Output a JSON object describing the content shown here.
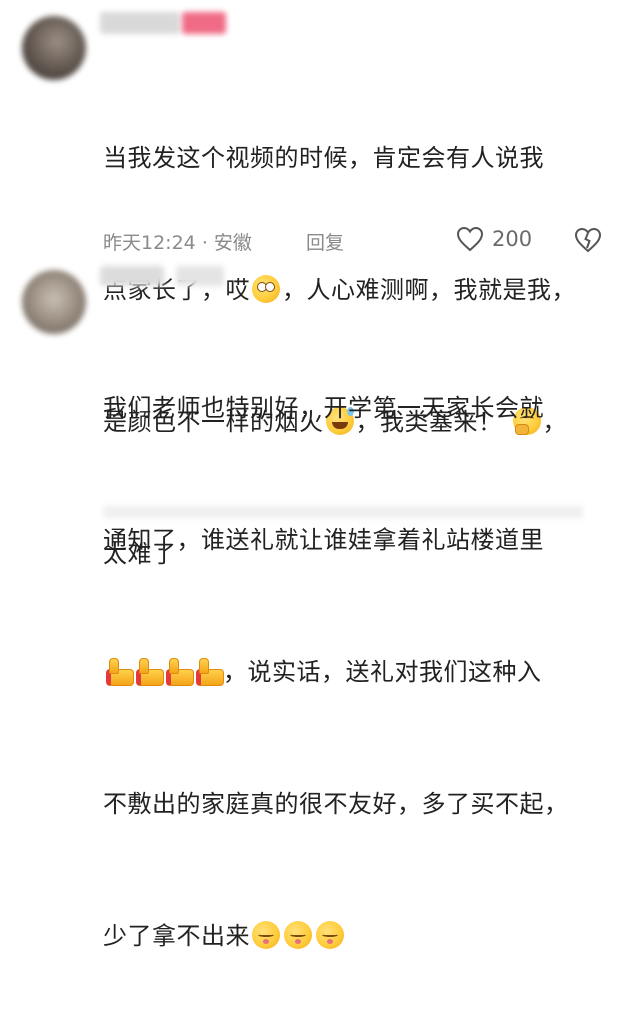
{
  "comments": [
    {
      "lines": [
        "当我发这个视频的时候，肯定会有人说我",
        "点家长了，哎",
        "，人心难测啊，我就是我，",
        "是颜色不一样的烟火",
        "，我类塞来！",
        "，",
        "太难了"
      ],
      "emoji": [
        "eye-roll-emoji",
        "sweat-smile-emoji",
        "thinking-emoji"
      ],
      "time": "昨天12:24",
      "separator": "·",
      "location": "安徽",
      "reply_label": "回复",
      "like_count": "200"
    },
    {
      "lines": [
        "我们老师也特别好，开学第一天家长会就",
        "通知了，谁送礼就让谁娃拿着礼站楼道里",
        "，说实话，送礼对我们这种入",
        "不敷出的家庭真的很不友好，多了买不起，",
        "少了拿不出来"
      ],
      "emoji": [
        "thumbs-up-emoji",
        "pouting-emoji"
      ]
    }
  ]
}
